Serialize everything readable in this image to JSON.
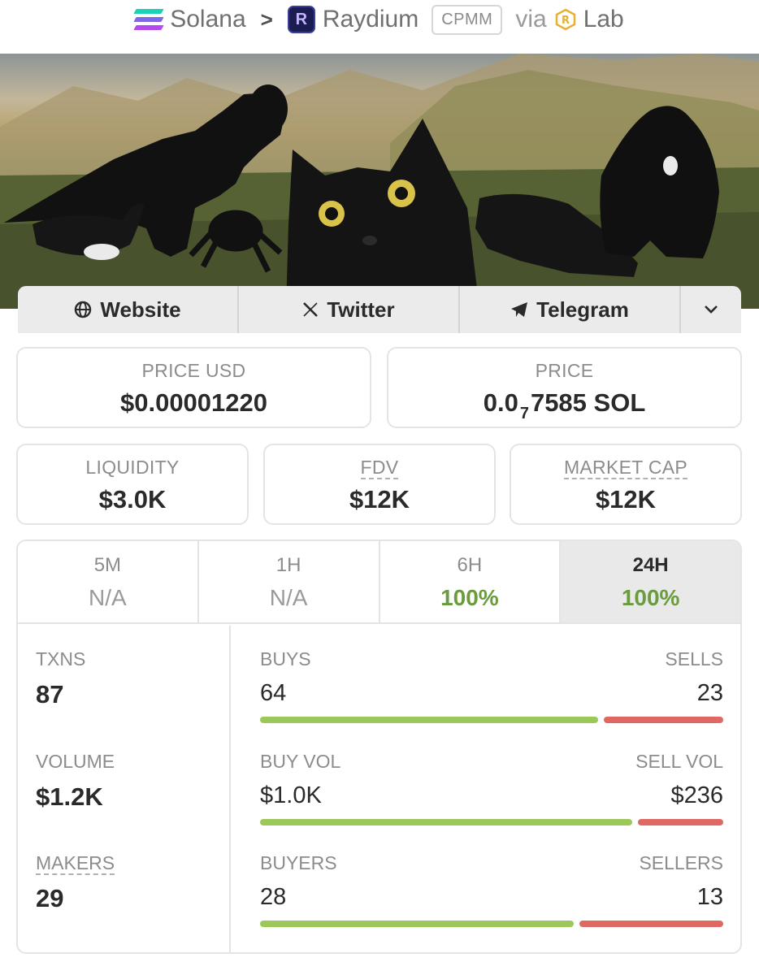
{
  "breadcrumb": {
    "chain": "Solana",
    "dex": "Raydium",
    "pool_type": "CPMM",
    "via_label": "via",
    "launchpad": "Lab",
    "separator": ">"
  },
  "banner": {
    "icons": [
      "dinosaur-figure",
      "cat-face",
      "spider-figure",
      "fish-figure",
      "crocodile-figure",
      "gorilla-figure"
    ]
  },
  "links": {
    "website": "Website",
    "twitter": "Twitter",
    "telegram": "Telegram",
    "expand_icon": "chevron-down-icon"
  },
  "price": {
    "usd_label": "PRICE USD",
    "usd_value": "$0.00001220",
    "native_label": "PRICE",
    "native_prefix": "0.0",
    "native_zeros": "7",
    "native_suffix": "7585 SOL"
  },
  "metrics": {
    "liquidity_label": "LIQUIDITY",
    "liquidity_value": "$3.0K",
    "fdv_label": "FDV",
    "fdv_value": "$12K",
    "mcap_label": "MARKET CAP",
    "mcap_value": "$12K"
  },
  "timeframes": [
    {
      "label": "5M",
      "value": "N/A"
    },
    {
      "label": "1H",
      "value": "N/A"
    },
    {
      "label": "6H",
      "value": "100%"
    },
    {
      "label": "24H",
      "value": "100%"
    }
  ],
  "selected_timeframe": "24H",
  "stats": {
    "txns_label": "TXNS",
    "txns_value": "87",
    "volume_label": "VOLUME",
    "volume_value": "$1.2K",
    "makers_label": "MAKERS",
    "makers_value": "29",
    "buys_label": "BUYS",
    "buys_value": "64",
    "sells_label": "SELLS",
    "sells_value": "23",
    "buy_vol_label": "BUY VOL",
    "buy_vol_value": "$1.0K",
    "sell_vol_label": "SELL VOL",
    "sell_vol_value": "$236",
    "buyers_label": "BUYERS",
    "buyers_value": "28",
    "sellers_label": "SELLERS",
    "sellers_value": "13"
  },
  "bar_ratios": {
    "txns_buy_fraction": 0.736,
    "volume_buy_fraction": 0.809,
    "makers_buy_fraction": 0.683
  },
  "colors": {
    "positive": "#6a9b3e",
    "buy_bar": "#9cc85a",
    "sell_bar": "#e06862"
  }
}
